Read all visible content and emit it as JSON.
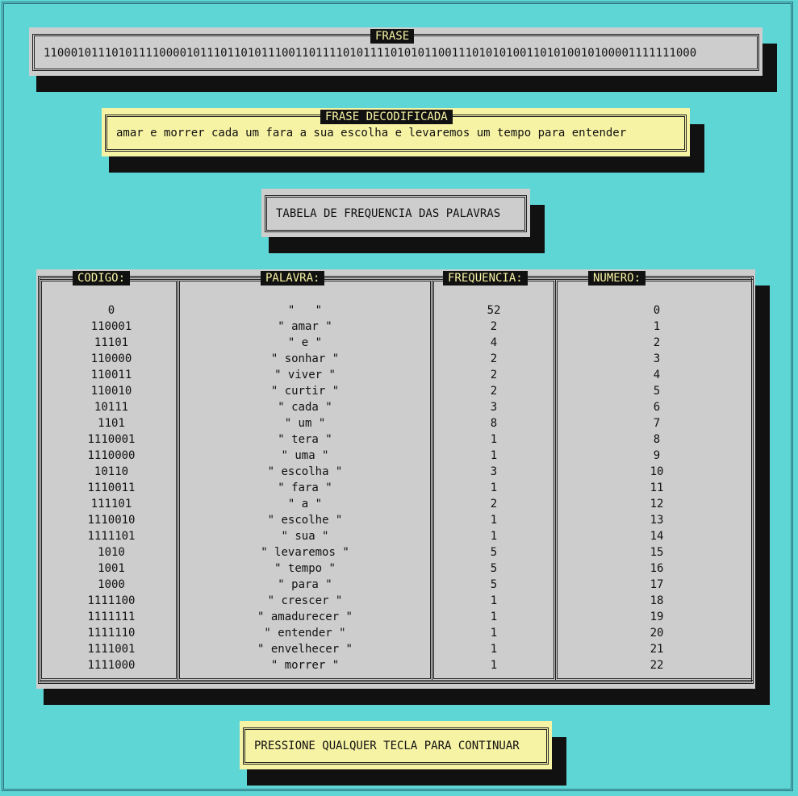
{
  "frase": {
    "title": "FRASE",
    "bits": "110001011101011110000101110110101110011011110101111010101100111010101001101010010100001111111000"
  },
  "decodificada": {
    "title": "FRASE DECODIFICADA",
    "text": "amar e morrer cada um fara a sua escolha e levaremos um tempo para entender"
  },
  "tabela_title": "TABELA DE FREQUENCIA DAS PALAVRAS",
  "table": {
    "headers": [
      "CODIGO:",
      "PALAVRA:",
      "FREQUENCIA:",
      "NUMERO:"
    ],
    "rows": [
      [
        "0",
        "\"   \"",
        "52",
        "0"
      ],
      [
        "110001",
        "\" amar \"",
        "2",
        "1"
      ],
      [
        "11101",
        "\" e \"",
        "4",
        "2"
      ],
      [
        "110000",
        "\" sonhar \"",
        "2",
        "3"
      ],
      [
        "110011",
        "\" viver \"",
        "2",
        "4"
      ],
      [
        "110010",
        "\" curtir \"",
        "2",
        "5"
      ],
      [
        "10111",
        "\" cada \"",
        "3",
        "6"
      ],
      [
        "1101",
        "\" um \"",
        "8",
        "7"
      ],
      [
        "1110001",
        "\" tera \"",
        "1",
        "8"
      ],
      [
        "1110000",
        "\" uma \"",
        "1",
        "9"
      ],
      [
        "10110",
        "\" escolha \"",
        "3",
        "10"
      ],
      [
        "1110011",
        "\" fara \"",
        "1",
        "11"
      ],
      [
        "111101",
        "\" a \"",
        "2",
        "12"
      ],
      [
        "1110010",
        "\" escolhe \"",
        "1",
        "13"
      ],
      [
        "1111101",
        "\" sua \"",
        "1",
        "14"
      ],
      [
        "1010",
        "\" levaremos \"",
        "5",
        "15"
      ],
      [
        "1001",
        "\" tempo \"",
        "5",
        "16"
      ],
      [
        "1000",
        "\" para \"",
        "5",
        "17"
      ],
      [
        "1111100",
        "\" crescer \"",
        "1",
        "18"
      ],
      [
        "1111111",
        "\" amadurecer \"",
        "1",
        "19"
      ],
      [
        "1111110",
        "\" entender \"",
        "1",
        "20"
      ],
      [
        "1111001",
        "\" envelhecer \"",
        "1",
        "21"
      ],
      [
        "1111000",
        "\" morrer \"",
        "1",
        "22"
      ]
    ]
  },
  "footer_prompt": "PRESSIONE QUALQUER TECLA PARA CONTINUAR",
  "colors": {
    "background": "#5fd6d6",
    "panel_gray": "#cdcdcd",
    "panel_yellow": "#f7f3a4",
    "title_bg": "#111111"
  }
}
